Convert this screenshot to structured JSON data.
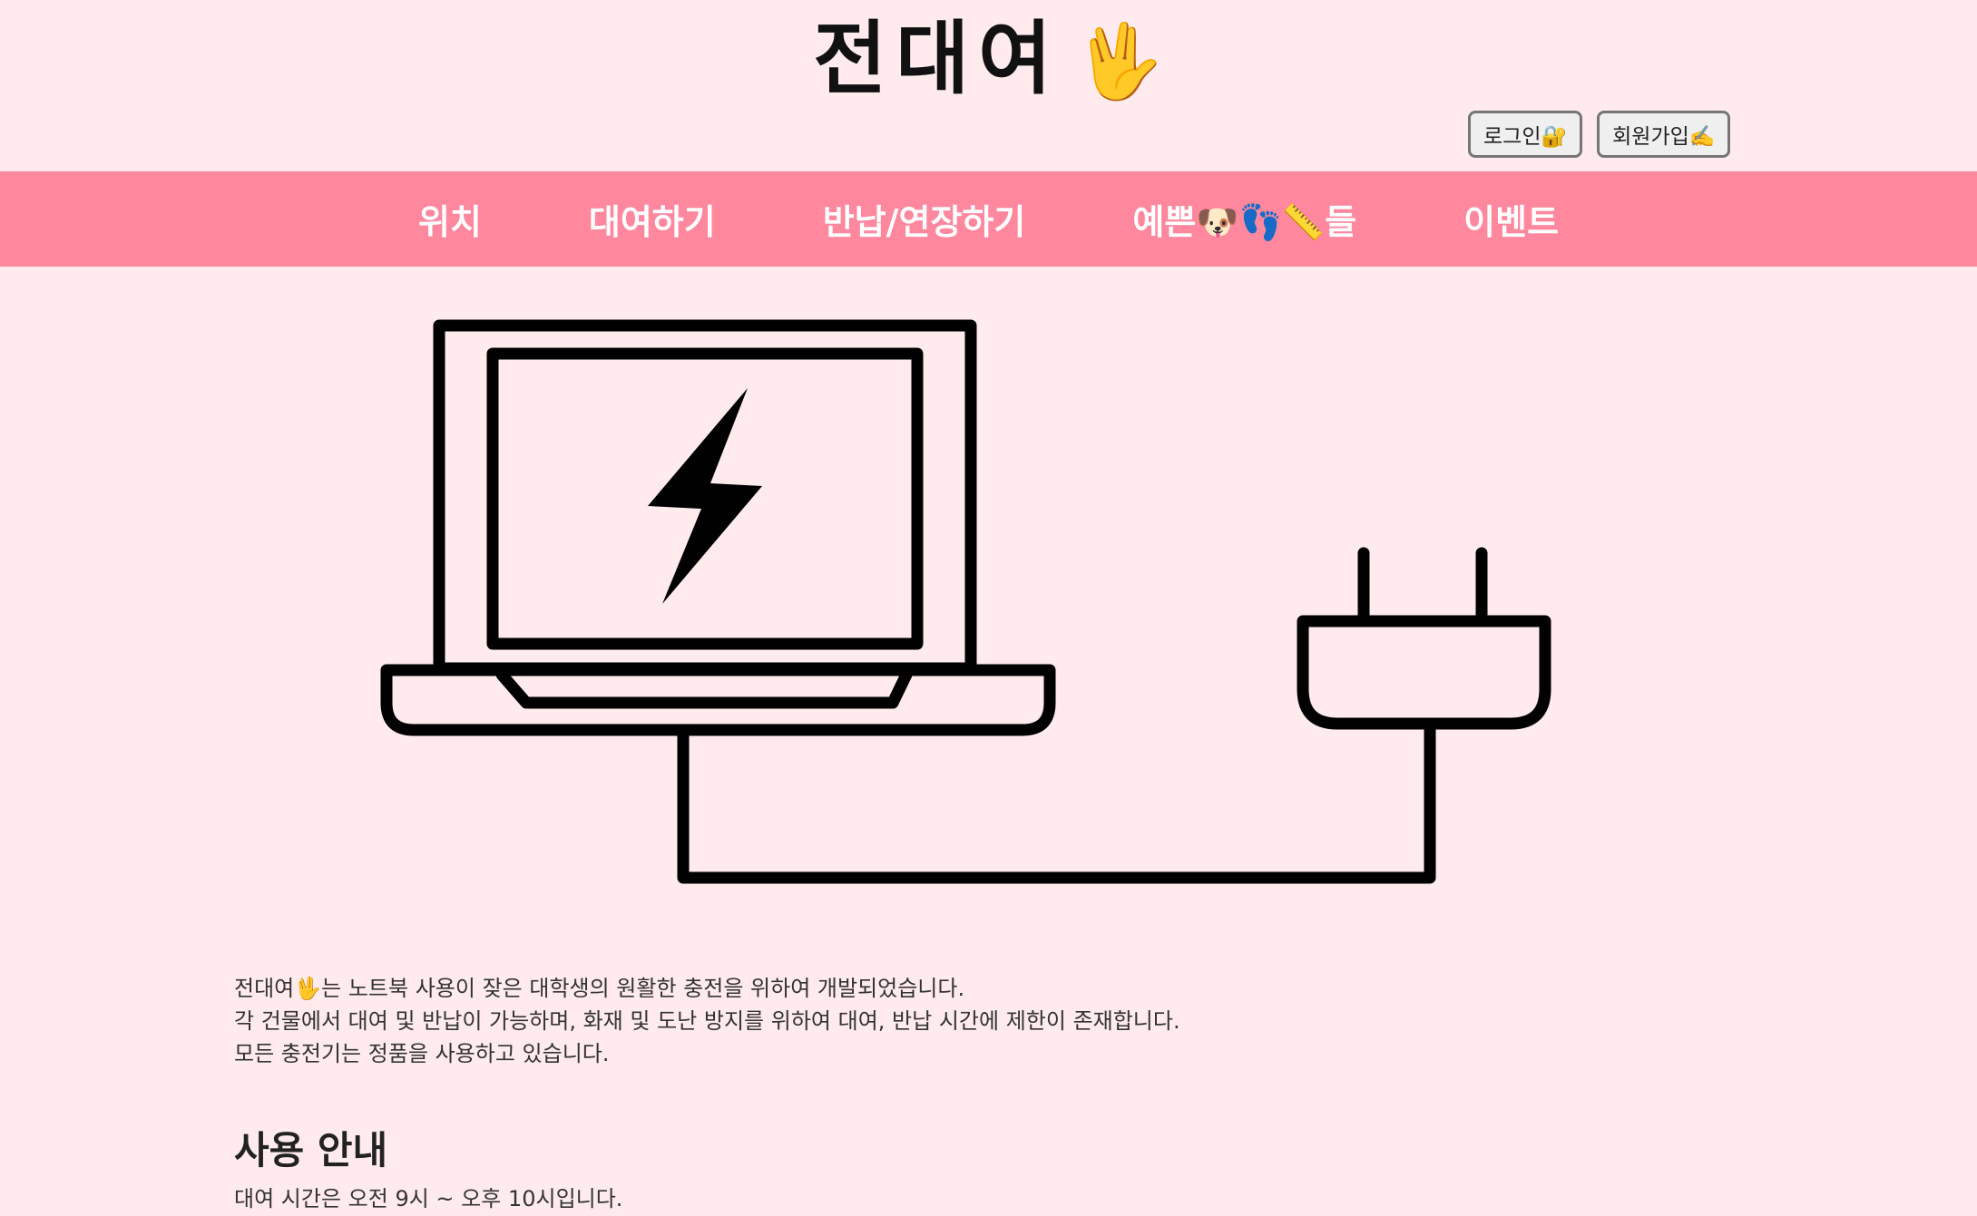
{
  "header": {
    "title": "전대여",
    "title_emoji": "🖖",
    "login_label": "로그인🔐",
    "signup_label": "회원가입✍️"
  },
  "nav": {
    "items": [
      {
        "label": "위치"
      },
      {
        "label": "대여하기"
      },
      {
        "label": "반납/연장하기"
      },
      {
        "label": "예쁜🐶👣📏들"
      },
      {
        "label": "이벤트"
      }
    ]
  },
  "hero": {
    "icon": "laptop-charging-plug-illustration"
  },
  "intro": {
    "line1": "전대여🖖는 노트북 사용이 잦은 대학생의 원활한 충전을 위하여 개발되었습니다.",
    "line2": "각 건물에서 대여 및 반납이 가능하며, 화재 및 도난 방지를 위하여 대여, 반납 시간에 제한이 존재합니다.",
    "line3": "모든 충전기는 정품을 사용하고 있습니다."
  },
  "usage": {
    "heading": "사용 안내",
    "hours": "대여 시간은 오전 9시 ~ 오후 10시입니다."
  },
  "colors": {
    "background": "#ffebed",
    "nav_background": "#ff879e",
    "nav_text": "#ffffff"
  }
}
